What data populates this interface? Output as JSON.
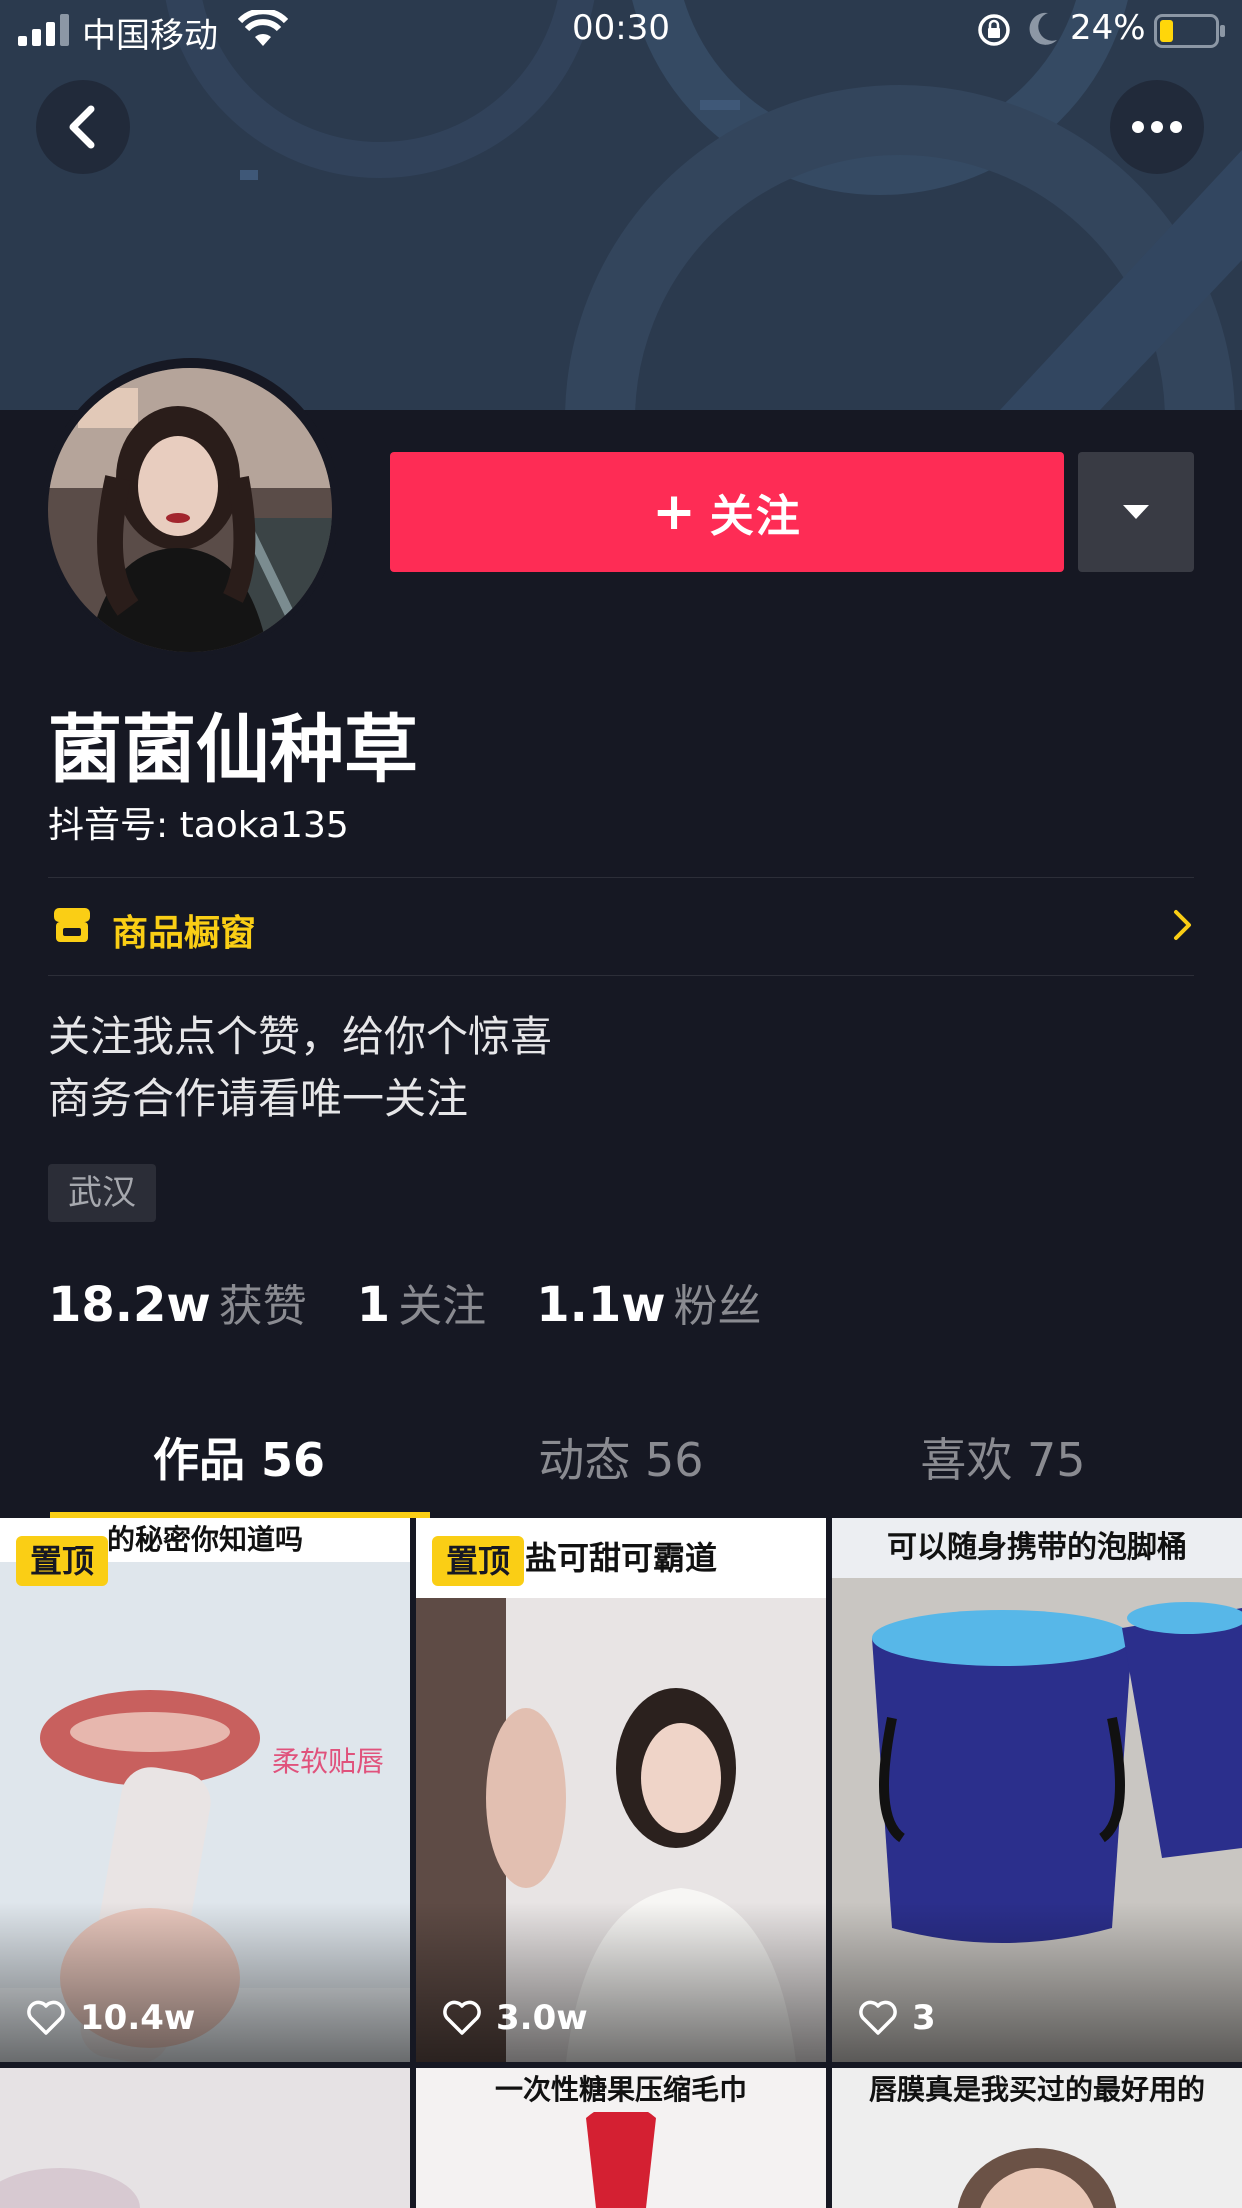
{
  "status_bar": {
    "carrier": "中国移动",
    "time": "00:30",
    "battery_percent": "24%",
    "battery_level": 0.24,
    "icons": [
      "signal-icon",
      "wifi-icon",
      "rotation-lock-icon",
      "moon-icon",
      "battery-icon"
    ]
  },
  "nav": {
    "back_icon": "chevron-left-icon",
    "more_icon": "more-dots-icon"
  },
  "profile": {
    "nickname": "菌菌仙种草",
    "douyin_id": "抖音号: taoka135",
    "follow_label": "关注",
    "follow_icon": "plus-icon",
    "dropdown_icon": "caret-down-icon",
    "showcase_label": "商品橱窗",
    "showcase_icon": "shop-icon",
    "bio_lines": [
      "关注我点个赞，给你个惊喜",
      "商务合作请看唯一关注"
    ],
    "location": "武汉"
  },
  "stats": [
    {
      "value": "18.2w",
      "label": "获赞"
    },
    {
      "value": "1",
      "label": "关注"
    },
    {
      "value": "1.1w",
      "label": "粉丝"
    }
  ],
  "tabs": [
    {
      "label": "作品 56",
      "active": true
    },
    {
      "label": "动态 56",
      "active": false
    },
    {
      "label": "喜欢 75",
      "active": false
    }
  ],
  "videos": [
    {
      "pinned": "置顶",
      "caption": "的秘密你知道吗",
      "overlay_text": "柔软贴唇",
      "likes": "10.4w"
    },
    {
      "pinned": "置顶",
      "caption": "盐可甜可霸道",
      "likes": "3.0w"
    },
    {
      "caption": "可以随身携带的泡脚桶",
      "likes": "3"
    },
    {
      "caption": ""
    },
    {
      "caption": "一次性糖果压缩毛巾"
    },
    {
      "caption": "唇膜真是我买过的最好用的"
    }
  ],
  "colors": {
    "background": "#161823",
    "follow_button": "#fe2c55",
    "accent_yellow": "#face15",
    "secondary_text": "#8a8b91"
  }
}
